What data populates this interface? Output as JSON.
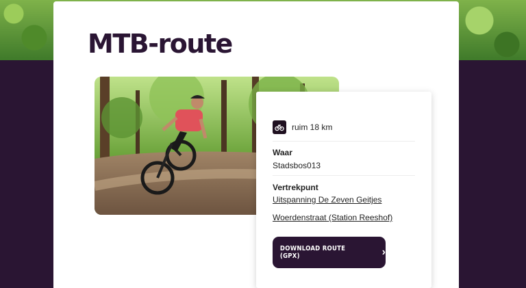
{
  "page": {
    "title": "MTB-route"
  },
  "route": {
    "distance": "ruim 18 km",
    "distance_icon": "bike-icon",
    "where_label": "Waar",
    "where_value": "Stadsbos013",
    "start_label": "Vertrekpunt",
    "start_links": [
      "Uitspanning De Zeven Geitjes",
      "Woerdenstraat (Station Reeshof)"
    ],
    "download_label": "DOWNLOAD ROUTE (GPX)",
    "download_icon": "chevron-right-icon"
  },
  "colors": {
    "brand_purple": "#2a1533",
    "background_green": "#5f9a36",
    "card": "#ffffff"
  }
}
